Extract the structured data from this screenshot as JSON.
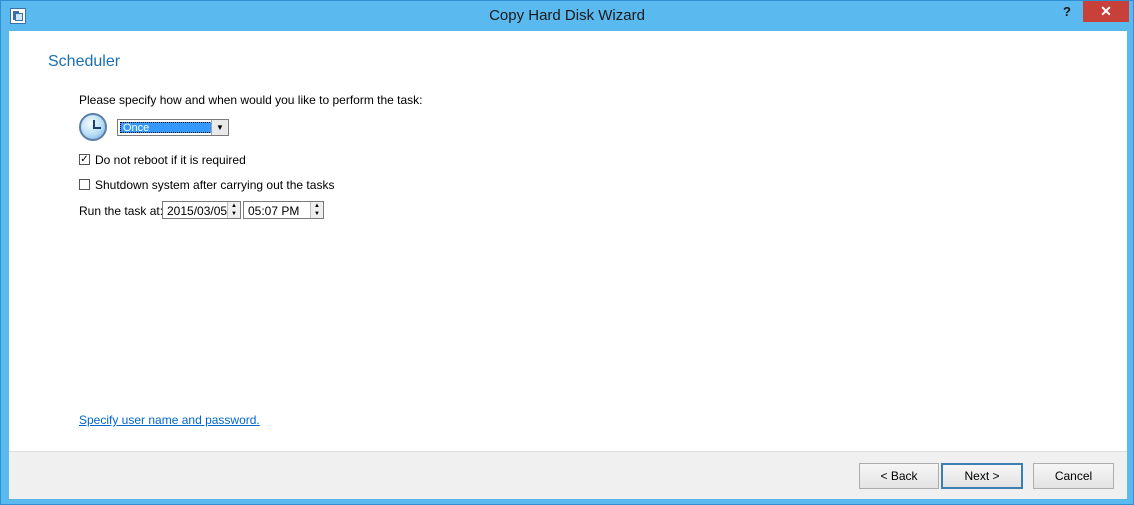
{
  "window": {
    "title": "Copy Hard Disk Wizard",
    "help_label": "?",
    "close_label": "✕"
  },
  "page": {
    "heading": "Scheduler",
    "prompt": "Please specify how and when would you like to perform the task:"
  },
  "schedule": {
    "frequency_value": "Once",
    "arrow": "▼"
  },
  "options": {
    "no_reboot": {
      "label": "Do not reboot if it is required",
      "checked": true,
      "mark": "✓"
    },
    "shutdown": {
      "label": "Shutdown system after carrying out the tasks",
      "checked": false,
      "mark": ""
    }
  },
  "run_at": {
    "label": "Run the task at:",
    "date": "2015/03/05",
    "time": "05:07 PM",
    "up": "▲",
    "down": "▼"
  },
  "link": {
    "credentials": "Specify user name and password."
  },
  "buttons": {
    "back": "< Back",
    "next": "Next >",
    "cancel": "Cancel"
  }
}
